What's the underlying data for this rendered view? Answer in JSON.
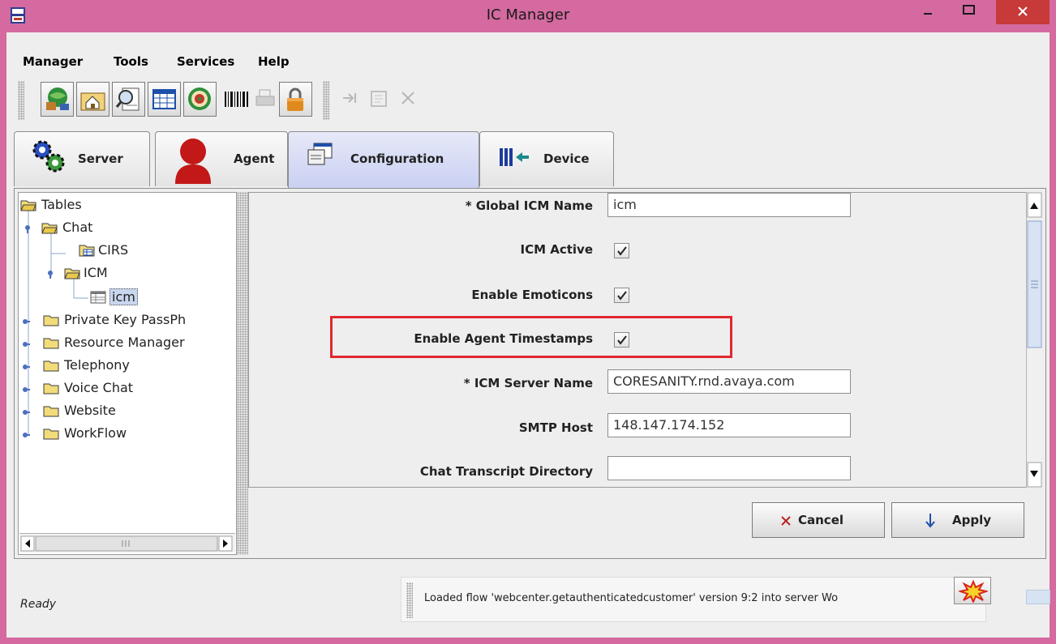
{
  "window": {
    "title": "IC Manager"
  },
  "menu": [
    "Manager",
    "Tools",
    "Services",
    "Help"
  ],
  "toolbar": {
    "buttons": [
      "globe-server-icon",
      "home-folder-icon",
      "search-document-icon",
      "table-icon",
      "dartboard-icon",
      "barcode-icon",
      "print-icon",
      "lock-icon",
      "import-icon",
      "edit-icon",
      "close-icon"
    ]
  },
  "tabs": [
    {
      "label": "Server",
      "icon": "gears-icon"
    },
    {
      "label": "Agent",
      "icon": "person-icon"
    },
    {
      "label": "Configuration",
      "icon": "configuration-icon",
      "active": true
    },
    {
      "label": "Device",
      "icon": "device-icon"
    }
  ],
  "tree": {
    "root": "Tables",
    "items": [
      "Chat",
      "CIRS",
      "ICM",
      "icm",
      "Private Key PassPh",
      "Resource Manager",
      "Telephony",
      "Voice Chat",
      "Website",
      "WorkFlow"
    ]
  },
  "form": {
    "global_icm_name_label": "* Global ICM Name",
    "global_icm_name_value": "icm",
    "icm_active_label": "ICM Active",
    "icm_active_checked": true,
    "enable_emoticons_label": "Enable Emoticons",
    "enable_emoticons_checked": true,
    "enable_agent_timestamps_label": "Enable Agent Timestamps",
    "enable_agent_timestamps_checked": true,
    "icm_server_name_label": "* ICM Server Name",
    "icm_server_name_value": "CORESANITY.rnd.avaya.com",
    "smtp_host_label": "SMTP Host",
    "smtp_host_value": "148.147.174.152",
    "chat_transcript_label": "Chat Transcript Directory",
    "chat_transcript_value": ""
  },
  "buttons": {
    "cancel": "Cancel",
    "apply": "Apply"
  },
  "status": {
    "text": "Ready",
    "message": "Loaded flow 'webcenter.getauthenticatedcustomer' version 9:2 into server Wo"
  },
  "colors": {
    "titlebar": "#d46aa0",
    "close": "#c8393a",
    "highlight": "#e0272e",
    "active_tab": "#c9d0f2"
  }
}
